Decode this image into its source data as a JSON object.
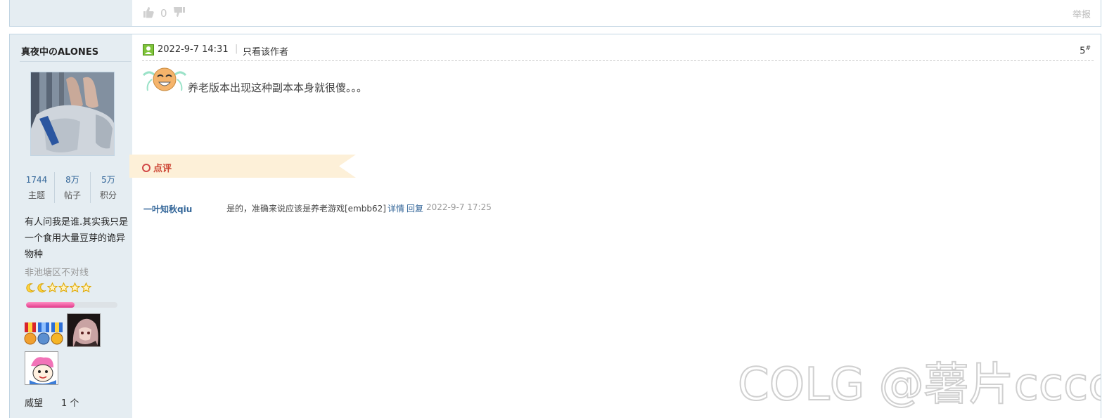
{
  "previous_post": {
    "like_count": "0",
    "report_label": "举报"
  },
  "post": {
    "author": "真夜中のALONES",
    "stats": [
      {
        "value": "1744",
        "label": "主题"
      },
      {
        "value": "8万",
        "label": "帖子"
      },
      {
        "value": "5万",
        "label": "积分"
      }
    ],
    "signature": "有人问我是谁.其实我只是一个食用大量豆芽的诡异物种",
    "custom_title": "非池塘区不对线",
    "rank": {
      "moons": 2,
      "stars": 4,
      "progress_fraction": 0.53
    },
    "prestige_label": "威望",
    "prestige_value": "1 个",
    "timestamp": "2022-9-7 14:31",
    "separator": "|",
    "only_author_label": "只看该作者",
    "floor_number": "5",
    "floor_mark": "#",
    "content": "养老版本出现这种副本本身就很傻。。。",
    "comment_section_label": "点评",
    "comments": [
      {
        "user": "一叶知秋qiu",
        "text": "是的，准确来说应该是养老游戏[embb62]",
        "detail_label": "详情",
        "reply_label": "回复",
        "time": "2022-9-7 17:25"
      }
    ]
  },
  "watermark_text": "COLG @薯片cccc",
  "colors": {
    "sidebar_bg": "#e5edf2",
    "border": "#c2d5e3",
    "link": "#336699",
    "comment_flag": "#fdf0d8",
    "rank_fill": "#e0398a"
  }
}
